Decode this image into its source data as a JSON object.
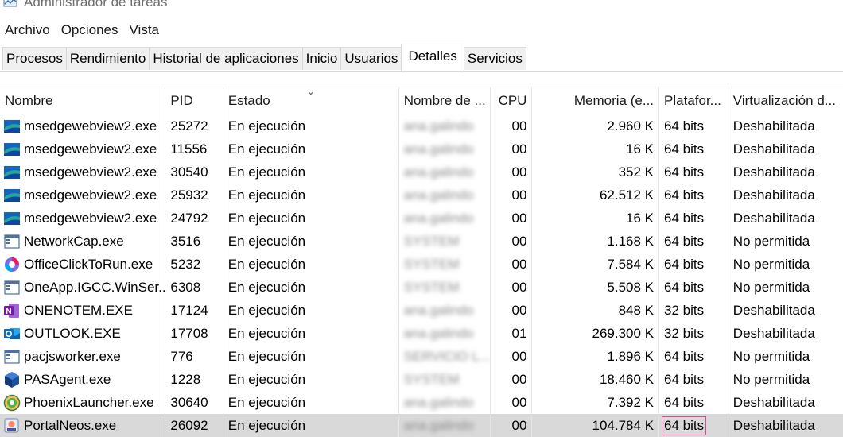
{
  "window": {
    "title": "Administrador de tareas"
  },
  "menu": [
    "Archivo",
    "Opciones",
    "Vista"
  ],
  "tabs": [
    {
      "label": "Procesos",
      "active": false
    },
    {
      "label": "Rendimiento",
      "active": false
    },
    {
      "label": "Historial de aplicaciones",
      "active": false
    },
    {
      "label": "Inicio",
      "active": false
    },
    {
      "label": "Usuarios",
      "active": false
    },
    {
      "label": "Detalles",
      "active": true
    },
    {
      "label": "Servicios",
      "active": false
    }
  ],
  "columns": {
    "name": "Nombre",
    "pid": "PID",
    "state": "Estado",
    "user": "Nombre de ...",
    "cpu": "CPU",
    "memory": "Memoria (e...",
    "platform": "Platafor...",
    "virtualization": "Virtualización d..."
  },
  "rows": [
    {
      "icon": "msedgewebview-icon",
      "name": "msedgewebview2.exe",
      "pid": "25272",
      "state": "En ejecución",
      "user": "ana.galindo",
      "cpu": "00",
      "memory": "2.960 K",
      "platform": "64 bits",
      "virtualization": "Deshabilitada",
      "selected": false
    },
    {
      "icon": "msedgewebview-icon",
      "name": "msedgewebview2.exe",
      "pid": "11556",
      "state": "En ejecución",
      "user": "ana.galindo",
      "cpu": "00",
      "memory": "16 K",
      "platform": "64 bits",
      "virtualization": "Deshabilitada",
      "selected": false
    },
    {
      "icon": "msedgewebview-icon",
      "name": "msedgewebview2.exe",
      "pid": "30540",
      "state": "En ejecución",
      "user": "ana.galindo",
      "cpu": "00",
      "memory": "352 K",
      "platform": "64 bits",
      "virtualization": "Deshabilitada",
      "selected": false
    },
    {
      "icon": "msedgewebview-icon",
      "name": "msedgewebview2.exe",
      "pid": "25932",
      "state": "En ejecución",
      "user": "ana.galindo",
      "cpu": "00",
      "memory": "62.512 K",
      "platform": "64 bits",
      "virtualization": "Deshabilitada",
      "selected": false
    },
    {
      "icon": "msedgewebview-icon",
      "name": "msedgewebview2.exe",
      "pid": "24792",
      "state": "En ejecución",
      "user": "ana.galindo",
      "cpu": "00",
      "memory": "16 K",
      "platform": "64 bits",
      "virtualization": "Deshabilitada",
      "selected": false
    },
    {
      "icon": "window-app-icon",
      "name": "NetworkCap.exe",
      "pid": "3516",
      "state": "En ejecución",
      "user": "SYSTEM",
      "cpu": "00",
      "memory": "1.168 K",
      "platform": "64 bits",
      "virtualization": "No permitida",
      "selected": false
    },
    {
      "icon": "office-icon",
      "name": "OfficeClickToRun.exe",
      "pid": "5232",
      "state": "En ejecución",
      "user": "SYSTEM",
      "cpu": "00",
      "memory": "7.584 K",
      "platform": "64 bits",
      "virtualization": "No permitida",
      "selected": false
    },
    {
      "icon": "window-app-icon",
      "name": "OneApp.IGCC.WinSer...",
      "pid": "6308",
      "state": "En ejecución",
      "user": "SYSTEM",
      "cpu": "00",
      "memory": "5.508 K",
      "platform": "64 bits",
      "virtualization": "No permitida",
      "selected": false
    },
    {
      "icon": "onenote-icon",
      "name": "ONENOTEM.EXE",
      "pid": "17124",
      "state": "En ejecución",
      "user": "ana.galindo",
      "cpu": "00",
      "memory": "848 K",
      "platform": "32 bits",
      "virtualization": "Deshabilitada",
      "selected": false
    },
    {
      "icon": "outlook-icon",
      "name": "OUTLOOK.EXE",
      "pid": "17708",
      "state": "En ejecución",
      "user": "ana.galindo",
      "cpu": "01",
      "memory": "269.300 K",
      "platform": "32 bits",
      "virtualization": "Deshabilitada",
      "selected": false
    },
    {
      "icon": "window-app-icon",
      "name": "pacjsworker.exe",
      "pid": "776",
      "state": "En ejecución",
      "user": "SERVICIO L...",
      "cpu": "00",
      "memory": "1.896 K",
      "platform": "64 bits",
      "virtualization": "No permitida",
      "selected": false
    },
    {
      "icon": "pasagent-icon",
      "name": "PASAgent.exe",
      "pid": "1228",
      "state": "En ejecución",
      "user": "SYSTEM",
      "cpu": "00",
      "memory": "18.460 K",
      "platform": "64 bits",
      "virtualization": "No permitida",
      "selected": false
    },
    {
      "icon": "phoenix-icon",
      "name": "PhoenixLauncher.exe",
      "pid": "30640",
      "state": "En ejecución",
      "user": "ana.galindo",
      "cpu": "00",
      "memory": "7.392 K",
      "platform": "64 bits",
      "virtualization": "Deshabilitada",
      "selected": false
    },
    {
      "icon": "portalneos-icon",
      "name": "PortalNeos.exe",
      "pid": "26092",
      "state": "En ejecución",
      "user": "ana.galindo",
      "cpu": "00",
      "memory": "104.784 K",
      "platform": "64 bits",
      "virtualization": "Deshabilitada",
      "selected": true
    }
  ],
  "colors": {
    "selected_row": "#d9d9d9",
    "highlight_box": "#d64a8f"
  }
}
